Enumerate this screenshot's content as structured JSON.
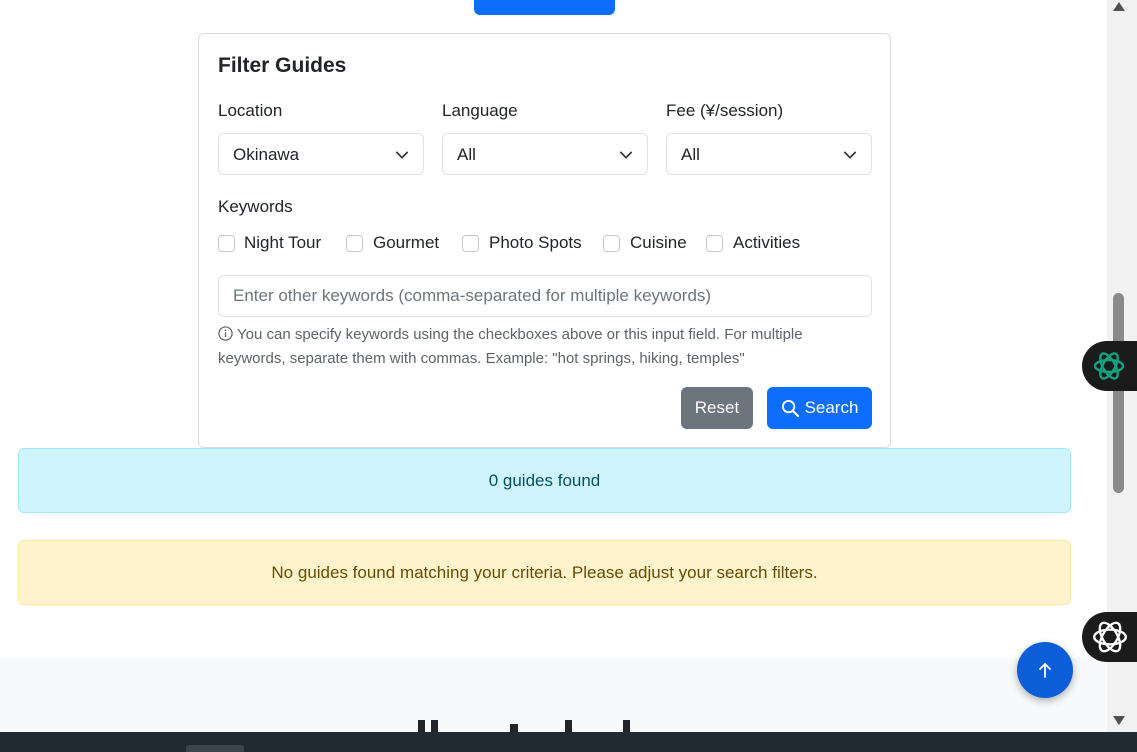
{
  "filter": {
    "title": "Filter Guides",
    "location": {
      "label": "Location",
      "value": "Okinawa"
    },
    "language": {
      "label": "Language",
      "value": "All"
    },
    "fee": {
      "label": "Fee (¥/session)",
      "value": "All"
    },
    "keywords_label": "Keywords",
    "checkboxes": [
      "Night Tour",
      "Gourmet",
      "Photo Spots",
      "Cuisine",
      "Activities"
    ],
    "keyword_input_placeholder": "Enter other keywords (comma-separated for multiple keywords)",
    "help_text": "You can specify keywords using the checkboxes above or this input field. For multiple keywords, separate them with commas. Example: \"hot springs, hiking, temples\"",
    "reset_label": "Reset",
    "search_label": "Search"
  },
  "results": {
    "count_text": "0 guides found",
    "empty_text": "No guides found matching your criteria. Please adjust your search filters."
  },
  "colors": {
    "primary": "#0d6efd",
    "secondary": "#6c757d",
    "info_bg": "#cff4fc",
    "warning_bg": "#fff3cd"
  },
  "icons": [
    "chevron-down-icon",
    "info-circle-icon",
    "search-icon",
    "arrow-up-icon",
    "chatgpt-icon",
    "openai-icon"
  ]
}
